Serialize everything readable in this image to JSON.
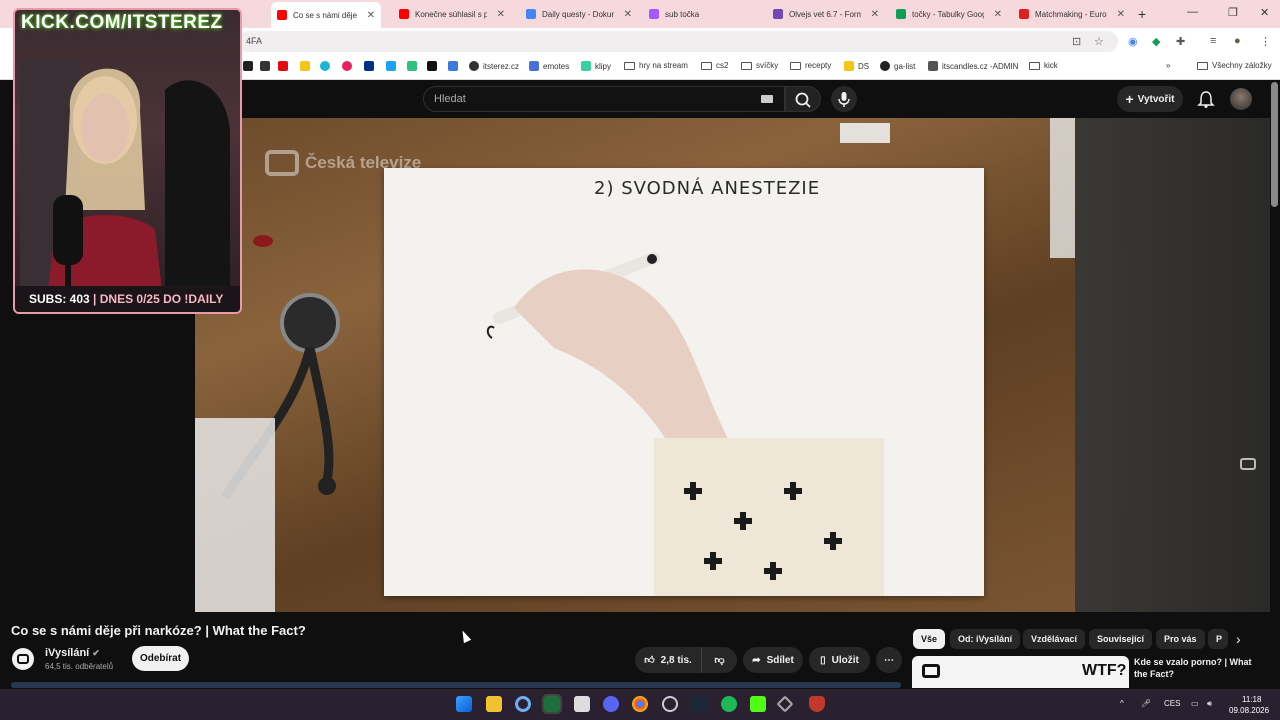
{
  "browser": {
    "tabs": [
      {
        "label": "Co se s námi děje",
        "active": true,
        "color": "#ff0000"
      },
      {
        "label": "Konečne súhlasil s prv",
        "color": "#ff0000"
      },
      {
        "label": "Daily questy - Dokum",
        "color": "#4285f4"
      },
      {
        "label": "sub točka",
        "color": "#a259ff"
      },
      {
        "label": "Olvejs vet 6.7 - Form",
        "color": "#7248b9"
      },
      {
        "label": "točky - Tabulky Goog",
        "color": "#0f9d58"
      },
      {
        "label": "Matchmaking - Europ",
        "color": "#e02020"
      }
    ],
    "address_fragment": "4FA",
    "bookmarks": [
      {
        "label": "itsterez.cz",
        "type": "site"
      },
      {
        "label": "emotes",
        "type": "site"
      },
      {
        "label": "klipy",
        "type": "site"
      },
      {
        "label": "hry na stream",
        "type": "folder"
      },
      {
        "label": "cs2",
        "type": "folder"
      },
      {
        "label": "svíčky",
        "type": "folder"
      },
      {
        "label": "recepty",
        "type": "folder"
      },
      {
        "label": "DS",
        "type": "site"
      },
      {
        "label": "ga-list",
        "type": "site"
      },
      {
        "label": "itscandles.cz -ADMIN",
        "type": "site"
      },
      {
        "label": "kick",
        "type": "folder"
      }
    ],
    "all_bookmarks": "Všechny záložky"
  },
  "youtube": {
    "search_placeholder": "Hledat",
    "create_label": "Vytvořit",
    "video": {
      "watermark": "Česká televize",
      "paper_text": "2) SVODNÁ ANESTEZIE"
    },
    "title": "Co se s námi děje při narkóze? | What the Fact?",
    "channel": {
      "name": "iVysílání",
      "subscribers": "64,5 tis. odběratelů",
      "subscribe_label": "Odebírat"
    },
    "actions": {
      "likes": "2,8 tis.",
      "share": "Sdílet",
      "save": "Uložit"
    },
    "chips": [
      "Vše",
      "Od: iVysílání",
      "Vzdělávací",
      "Související",
      "Pro vás",
      "P"
    ],
    "recommendation": {
      "thumb_text": "WTF?",
      "title": "Kde se vzalo porno? | What the Fact?"
    }
  },
  "stream_overlay": {
    "title": "KICK.COM/ITSTEREZ",
    "subs_label": "SUBS: 403",
    "goal_label": "| DNES 0/25 DO !DAILY"
  },
  "taskbar": {
    "language": "CES",
    "time": "11:18",
    "date": "09.08.2026"
  }
}
